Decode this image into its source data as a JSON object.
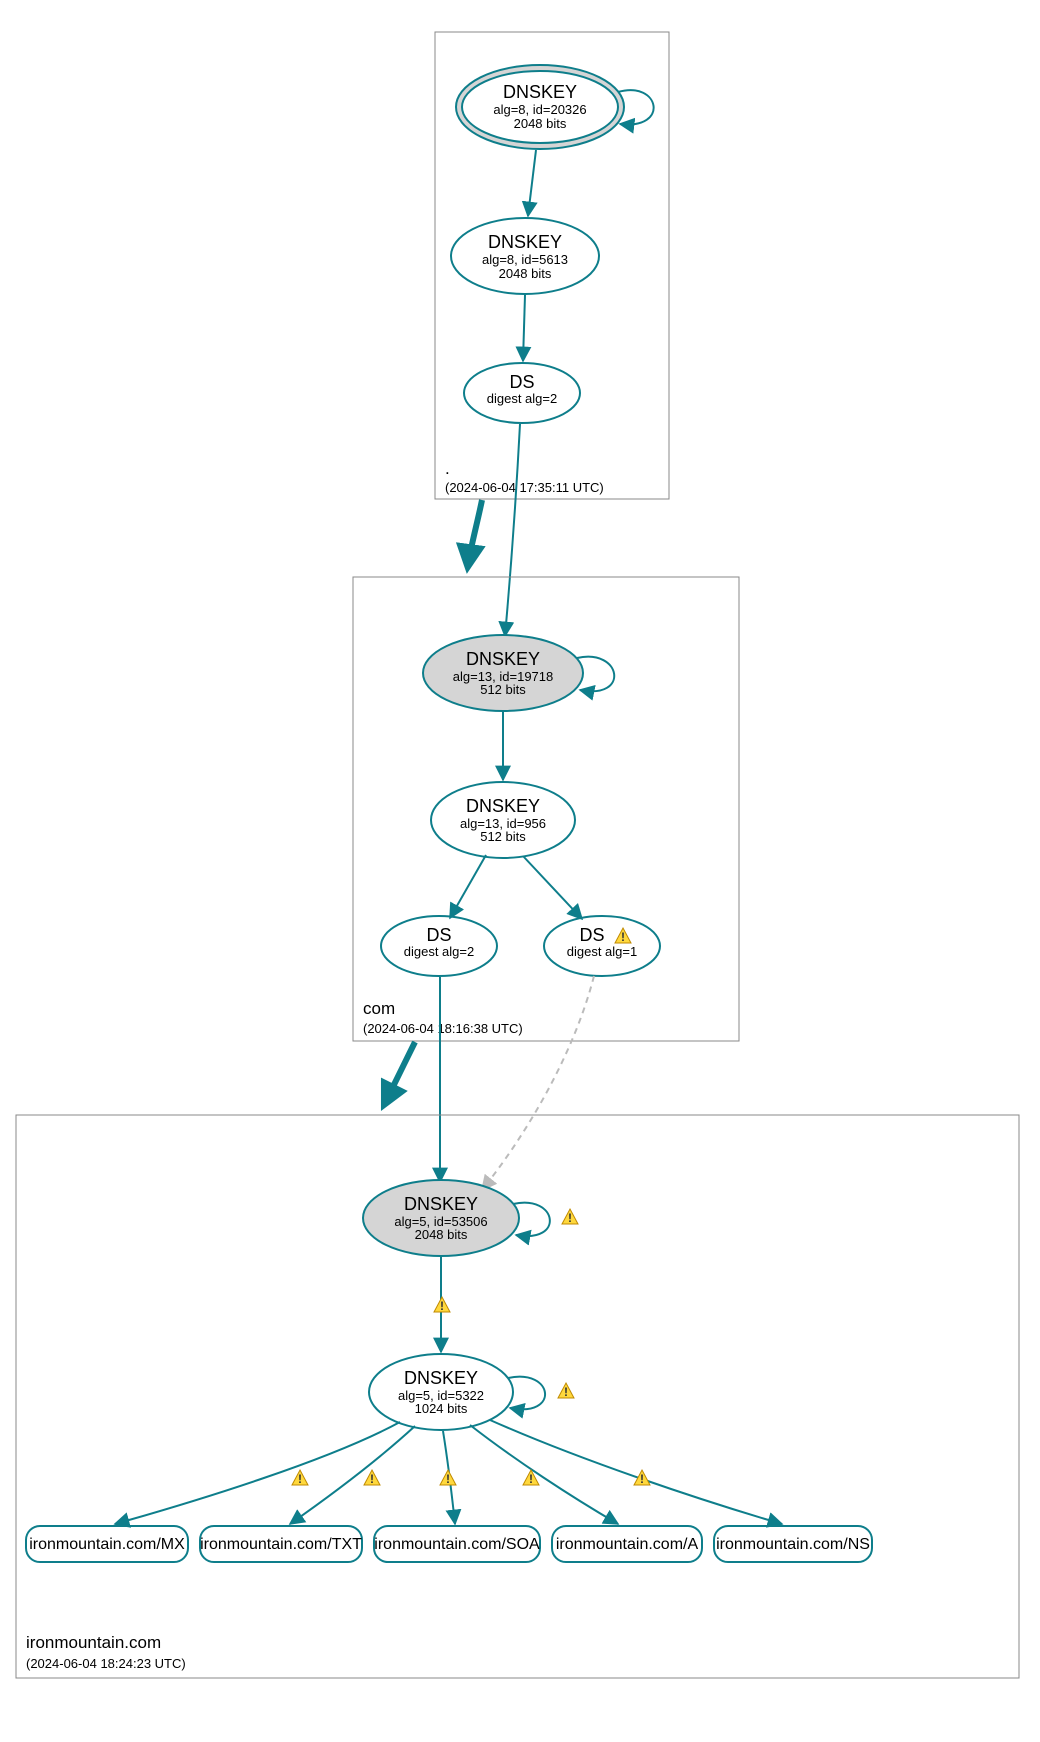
{
  "colors": {
    "edge": "#0e7e8b",
    "shaded": "#d5d5d5",
    "warn": "#ffd83d"
  },
  "zones": {
    "root": {
      "label": ".",
      "timestamp": "(2024-06-04 17:35:11 UTC)"
    },
    "com": {
      "label": "com",
      "timestamp": "(2024-06-04 18:16:38 UTC)"
    },
    "ironmountain": {
      "label": "ironmountain.com",
      "timestamp": "(2024-06-04 18:24:23 UTC)"
    }
  },
  "nodes": {
    "root_ksk": {
      "title": "DNSKEY",
      "l2": "alg=8, id=20326",
      "l3": "2048 bits"
    },
    "root_zsk": {
      "title": "DNSKEY",
      "l2": "alg=8, id=5613",
      "l3": "2048 bits"
    },
    "root_ds": {
      "title": "DS",
      "l2": "digest alg=2"
    },
    "com_ksk": {
      "title": "DNSKEY",
      "l2": "alg=13, id=19718",
      "l3": "512 bits"
    },
    "com_zsk": {
      "title": "DNSKEY",
      "l2": "alg=13, id=956",
      "l3": "512 bits"
    },
    "com_ds1": {
      "title": "DS",
      "l2": "digest alg=2"
    },
    "com_ds2": {
      "title": "DS",
      "l2": "digest alg=1"
    },
    "im_ksk": {
      "title": "DNSKEY",
      "l2": "alg=5, id=53506",
      "l3": "2048 bits"
    },
    "im_zsk": {
      "title": "DNSKEY",
      "l2": "alg=5, id=5322",
      "l3": "1024 bits"
    }
  },
  "records": {
    "mx": "ironmountain.com/MX",
    "txt": "ironmountain.com/TXT",
    "soa": "ironmountain.com/SOA",
    "a": "ironmountain.com/A",
    "ns": "ironmountain.com/NS"
  }
}
